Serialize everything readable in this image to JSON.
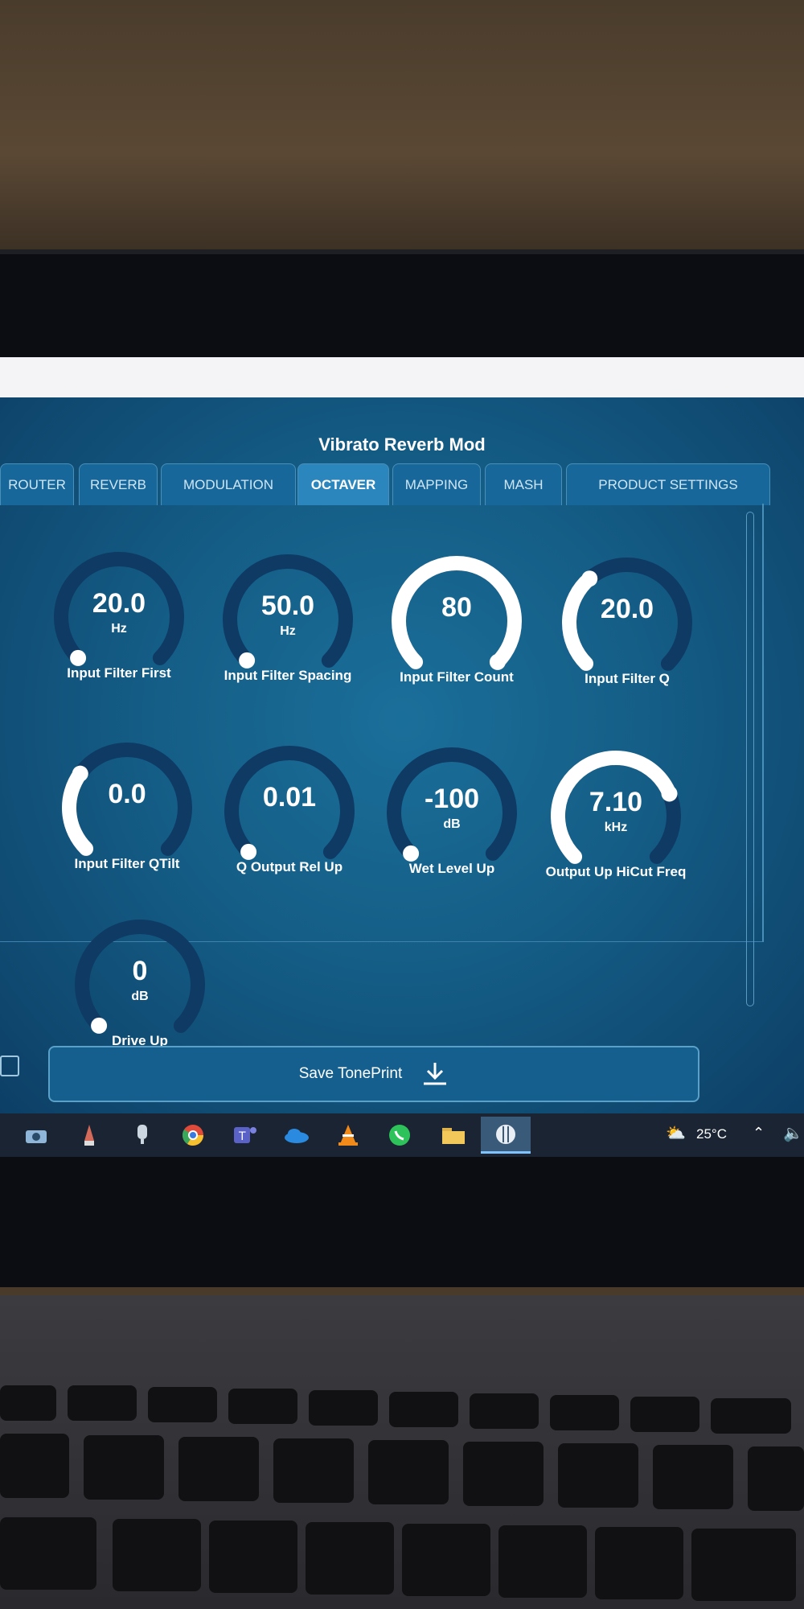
{
  "app": {
    "title": "Vibrato Reverb Mod",
    "tabs": [
      {
        "label": "ROUTER",
        "active": false
      },
      {
        "label": "REVERB",
        "active": false
      },
      {
        "label": "MODULATION",
        "active": false
      },
      {
        "label": "OCTAVER",
        "active": true
      },
      {
        "label": "MAPPING",
        "active": false
      },
      {
        "label": "MASH",
        "active": false
      },
      {
        "label": "PRODUCT SETTINGS",
        "active": false
      }
    ],
    "knobs": [
      {
        "value": "20.0",
        "unit": "Hz",
        "label": "Input Filter First",
        "level": 0.0
      },
      {
        "value": "50.0",
        "unit": "Hz",
        "label": "Input Filter Spacing",
        "level": 0.0
      },
      {
        "value": "80",
        "unit": "",
        "label": "Input Filter Count",
        "level": 1.0
      },
      {
        "value": "20.0",
        "unit": "",
        "label": "Input Filter Q",
        "level": 0.35
      },
      {
        "value": "0.0",
        "unit": "",
        "label": "Input Filter QTilt",
        "level": 0.3
      },
      {
        "value": "0.01",
        "unit": "",
        "label": "Q Output Rel Up",
        "level": 0.0
      },
      {
        "value": "-100",
        "unit": "dB",
        "label": "Wet Level Up",
        "level": 0.0
      },
      {
        "value": "7.10",
        "unit": "kHz",
        "label": "Output Up HiCut Freq",
        "level": 0.75
      },
      {
        "value": "0",
        "unit": "dB",
        "label": "Drive Up",
        "level": 0.0
      }
    ],
    "save_label": "Save TonePrint"
  },
  "colors": {
    "knob_track": "#0e3a64",
    "knob_fill": "#ffffff",
    "active_tab": "#2a86bd"
  },
  "taskbar": {
    "icons": [
      "camera-icon",
      "pen-icon",
      "microphone-icon",
      "chrome-icon",
      "teams-icon",
      "onedrive-icon",
      "vlc-icon",
      "whatsapp-icon",
      "folder-icon",
      "tc-app-icon"
    ],
    "temperature": "25°C"
  }
}
